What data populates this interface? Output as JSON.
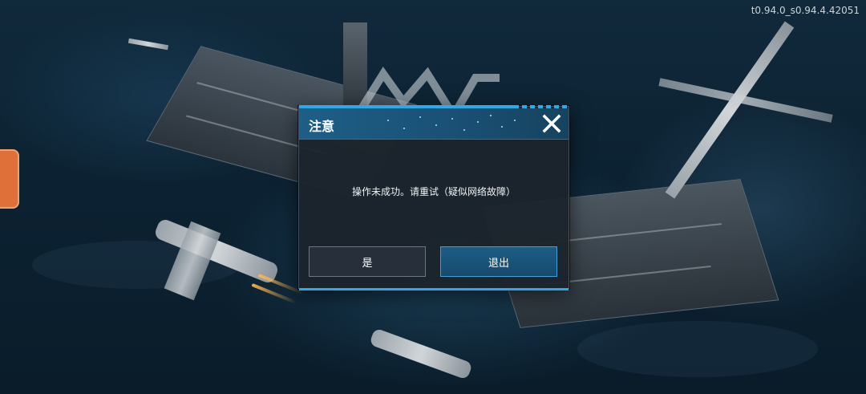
{
  "version": "t0.94.0_s0.94.4.42051",
  "dialog": {
    "title": "注意",
    "message": "操作未成功。请重试（疑似网络故障）",
    "yes_label": "是",
    "exit_label": "退出",
    "close_icon": "close-icon"
  },
  "colors": {
    "accent": "#2ba9e8",
    "header": "#1e5f87",
    "dialog_bg": "#1c242c",
    "exit_button": "#1d5c85"
  }
}
